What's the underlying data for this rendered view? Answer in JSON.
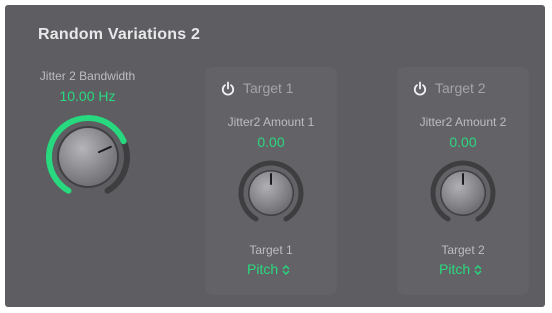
{
  "section": {
    "title": "Random Variations 2"
  },
  "bandwidth": {
    "label": "Jitter 2 Bandwidth",
    "value": "10.00 Hz",
    "fraction": 0.72
  },
  "targets": [
    {
      "title": "Target 1",
      "amount_label": "Jitter2 Amount 1",
      "amount_value": "0.00",
      "amount_fraction": 0.5,
      "target_label": "Target 1",
      "target_value": "Pitch"
    },
    {
      "title": "Target 2",
      "amount_label": "Jitter2 Amount 2",
      "amount_value": "0.00",
      "amount_fraction": 0.5,
      "target_label": "Target 2",
      "target_value": "Pitch"
    }
  ],
  "colors": {
    "accent": "#29d97f",
    "panel": "#5e5e62",
    "box": "#636367"
  },
  "icons": {
    "power": "power-icon",
    "popup": "chevron-updown-icon"
  }
}
